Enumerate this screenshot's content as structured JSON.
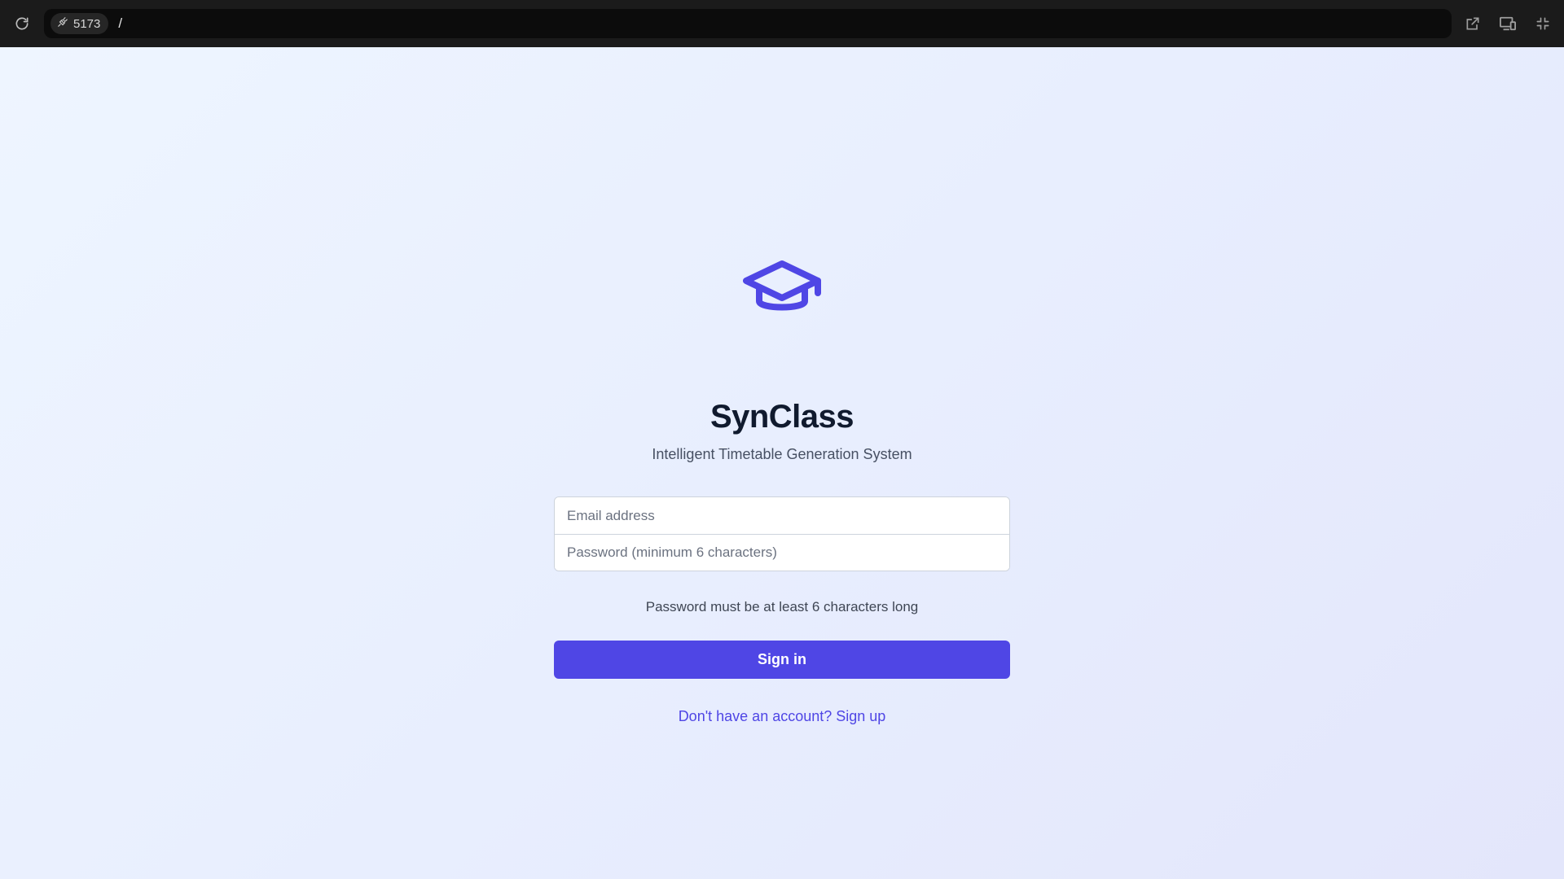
{
  "browser": {
    "port": "5173",
    "path": "/"
  },
  "app": {
    "title": "SynClass",
    "subtitle": "Intelligent Timetable Generation System",
    "logo_icon": "graduation-cap-icon",
    "accent_color": "#4f46e5"
  },
  "form": {
    "email_placeholder": "Email address",
    "email_value": "",
    "password_placeholder": "Password (minimum 6 characters)",
    "password_value": "",
    "hint": "Password must be at least 6 characters long",
    "submit_label": "Sign in",
    "signup_link": "Don't have an account? Sign up"
  }
}
